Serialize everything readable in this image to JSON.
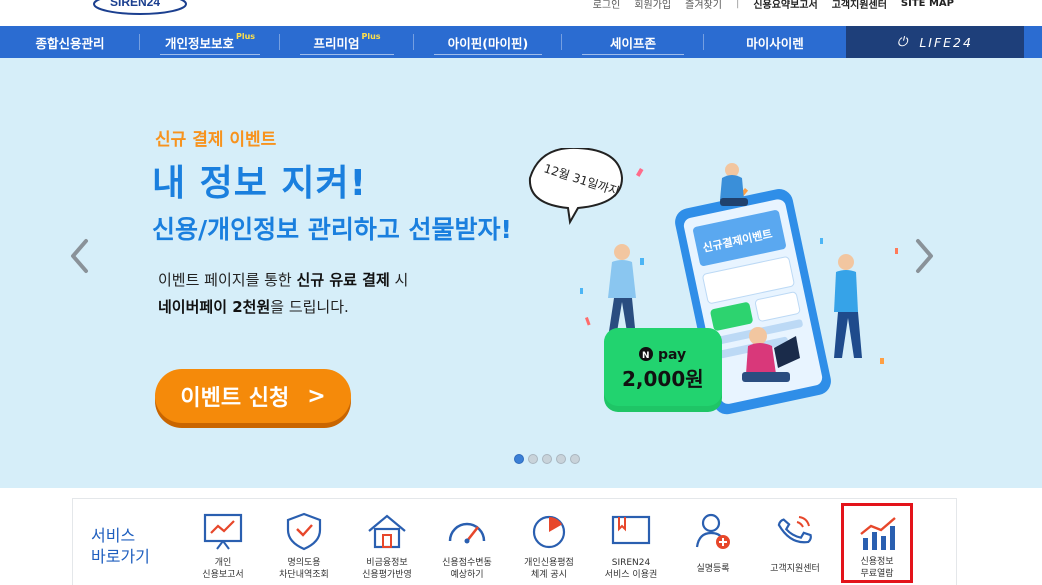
{
  "header": {
    "logo_text": "SIREN24",
    "util_links": [
      "로그인",
      "회원가입",
      "즐겨찾기",
      "신용요약보고서",
      "고객지원센터",
      "SITE MAP"
    ]
  },
  "nav": {
    "items": [
      {
        "label": "종합신용관리",
        "plus": ""
      },
      {
        "label": "개인정보보호",
        "plus": "Plus"
      },
      {
        "label": "프리미엄",
        "plus": "Plus"
      },
      {
        "label": "아이핀(마이핀)",
        "plus": ""
      },
      {
        "label": "세이프존",
        "plus": ""
      },
      {
        "label": "마이사이렌",
        "plus": ""
      },
      {
        "label": "LIFE24",
        "plus": ""
      }
    ]
  },
  "banner": {
    "sub": "신규 결제 이벤트",
    "title1": "내 정보 지켜!",
    "title2": "신용/개인정보 관리하고 선물받자!",
    "desc1_pre": "이벤트 페이지를 통한 ",
    "desc1_bold": "신규 유료 결제",
    "desc1_post": " 시",
    "desc2_bold": "네이버페이 2천원",
    "desc2_post": "을 드립니다.",
    "cta_label": "이벤트 신청",
    "cta_arrow": ">",
    "bubble_text": "12월 31일까지",
    "npay_label": "pay",
    "npay_amount": "2,000원",
    "dots_total": 5,
    "dots_active": 0
  },
  "services": {
    "title_line1": "서비스",
    "title_line2": "바로가기",
    "items": [
      {
        "line1": "개인",
        "line2": "신용보고서",
        "icon": "presentation-chart-icon"
      },
      {
        "line1": "명의도용",
        "line2": "차단내역조회",
        "icon": "shield-check-icon"
      },
      {
        "line1": "비금융정보",
        "line2": "신용평가반영",
        "icon": "house-icon"
      },
      {
        "line1": "신용점수변동",
        "line2": "예상하기",
        "icon": "gauge-icon"
      },
      {
        "line1": "개인신용평점",
        "line2": "체계 공시",
        "icon": "pie-chart-icon"
      },
      {
        "line1": "SIREN24",
        "line2": "서비스 이용권",
        "icon": "ticket-icon"
      },
      {
        "line1": "실명등록",
        "line2": "",
        "icon": "user-add-icon"
      },
      {
        "line1": "고객지원센터",
        "line2": "",
        "icon": "phone-icon"
      },
      {
        "line1": "신용정보",
        "line2": "무료열람",
        "icon": "bar-chart-icon"
      }
    ]
  },
  "colors": {
    "nav_blue": "#2b6cd1",
    "banner_bg": "#d6eef9",
    "accent_orange": "#f58a0a",
    "title_blue": "#1a7fde",
    "highlight_red": "#e3131a"
  }
}
